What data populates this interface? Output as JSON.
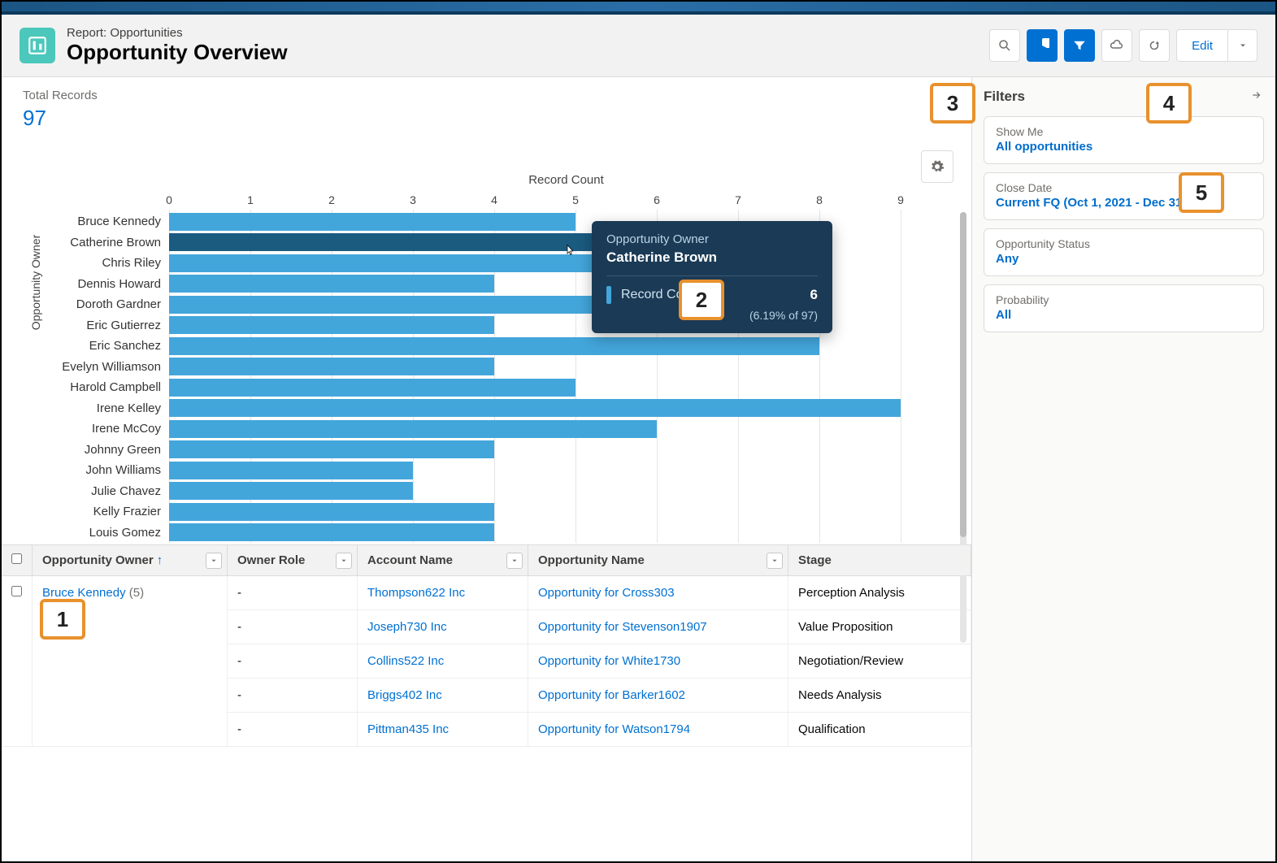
{
  "header": {
    "eyebrow": "Report: Opportunities",
    "title": "Opportunity Overview",
    "edit_label": "Edit"
  },
  "kpi": {
    "label": "Total Records",
    "value": "97"
  },
  "chart_data": {
    "type": "bar",
    "orientation": "horizontal",
    "title": "Record Count",
    "xlabel": "Record Count",
    "ylabel": "Opportunity Owner",
    "xlim": [
      0,
      9
    ],
    "ticks": [
      0,
      1,
      2,
      3,
      4,
      5,
      6,
      7,
      8,
      9
    ],
    "categories": [
      "Bruce Kennedy",
      "Catherine Brown",
      "Chris Riley",
      "Dennis Howard",
      "Doroth Gardner",
      "Eric Gutierrez",
      "Eric Sanchez",
      "Evelyn Williamson",
      "Harold Campbell",
      "Irene Kelley",
      "Irene McCoy",
      "Johnny Green",
      "John Williams",
      "Julie Chavez",
      "Kelly Frazier",
      "Louis Gomez"
    ],
    "values": [
      5,
      6,
      8,
      4,
      8,
      4,
      8,
      4,
      5,
      9,
      6,
      4,
      3,
      3,
      4,
      4
    ],
    "highlight_index": 1,
    "tooltip": {
      "eyebrow": "Opportunity Owner",
      "name": "Catherine Brown",
      "metric_label": "Record Count",
      "metric_value": "6",
      "pct": "(6.19% of 97)"
    }
  },
  "table": {
    "columns": [
      "Opportunity Owner",
      "Owner Role",
      "Account Name",
      "Opportunity Name",
      "Stage"
    ],
    "sort_column": "Opportunity Owner",
    "sort_dir": "asc",
    "group": {
      "owner": "Bruce Kennedy",
      "count": "(5)"
    },
    "rows": [
      {
        "owner_role": "-",
        "account": "Thompson622 Inc",
        "opportunity": "Opportunity for Cross303",
        "stage": "Perception Analysis"
      },
      {
        "owner_role": "-",
        "account": "Joseph730 Inc",
        "opportunity": "Opportunity for Stevenson1907",
        "stage": "Value Proposition"
      },
      {
        "owner_role": "-",
        "account": "Collins522 Inc",
        "opportunity": "Opportunity for White1730",
        "stage": "Negotiation/Review"
      },
      {
        "owner_role": "-",
        "account": "Briggs402 Inc",
        "opportunity": "Opportunity for Barker1602",
        "stage": "Needs Analysis"
      },
      {
        "owner_role": "-",
        "account": "Pittman435 Inc",
        "opportunity": "Opportunity for Watson1794",
        "stage": "Qualification"
      }
    ]
  },
  "filters": {
    "title": "Filters",
    "items": [
      {
        "label": "Show Me",
        "value": "All opportunities"
      },
      {
        "label": "Close Date",
        "value": "Current FQ (Oct 1, 2021 - Dec 31, 2021)"
      },
      {
        "label": "Opportunity Status",
        "value": "Any"
      },
      {
        "label": "Probability",
        "value": "All"
      }
    ]
  },
  "callouts": {
    "1": "1",
    "2": "2",
    "3": "3",
    "4": "4",
    "5": "5"
  }
}
